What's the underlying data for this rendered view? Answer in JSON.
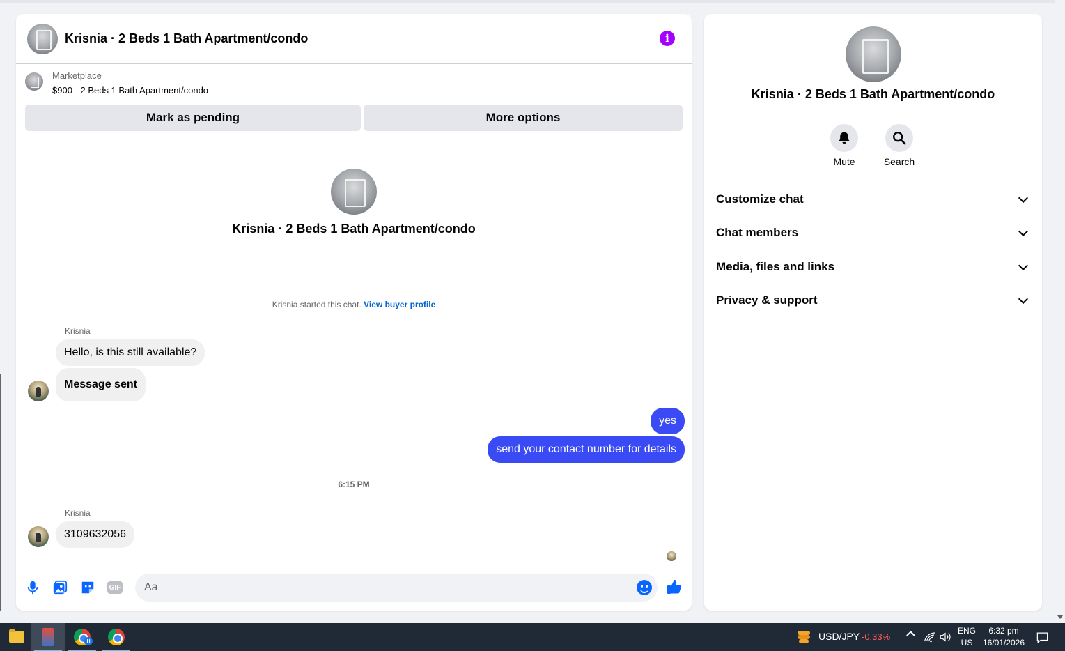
{
  "chat": {
    "header_title": "Krisnia · 2 Beds 1 Bath Apartment/condo",
    "info_icon_glyph": "i",
    "marketplace": {
      "label": "Marketplace",
      "listing": "$900 - 2 Beds 1 Bath Apartment/condo",
      "mark_pending_label": "Mark as pending",
      "more_options_label": "More options"
    },
    "intro_title": "Krisnia · 2 Beds 1 Bath Apartment/condo",
    "started_text": "Krisnia started this chat.",
    "view_buyer_profile": "View buyer profile",
    "messages": [
      {
        "sender": "Krisnia",
        "text": "Hello, is this still available?"
      },
      {
        "text": "Message sent"
      },
      {
        "text": "yes"
      },
      {
        "text": "send your contact number for details"
      },
      {
        "sender": "Krisnia",
        "text": "3109632056"
      }
    ],
    "timestamp": "6:15 PM",
    "composer": {
      "placeholder": "Aa",
      "gif_label": "GIF"
    }
  },
  "info_panel": {
    "title": "Krisnia · 2 Beds 1 Bath Apartment/condo",
    "actions": [
      {
        "label": "Mute",
        "icon": "bell-icon"
      },
      {
        "label": "Search",
        "icon": "search-icon"
      }
    ],
    "sections": [
      {
        "label": "Customize chat"
      },
      {
        "label": "Chat members"
      },
      {
        "label": "Media, files and links"
      },
      {
        "label": "Privacy & support"
      }
    ]
  },
  "taskbar": {
    "ticker_label": "USD/JPY",
    "ticker_change": "-0.33%",
    "chrome_badge": "H",
    "lang_top": "ENG",
    "lang_bottom": "US",
    "time": "6:32 pm",
    "date": "16/01/2026"
  },
  "colors": {
    "accent": "#0866ff",
    "outgoing_bubble": "#3a4bf5",
    "info_icon": "#a400ff",
    "ticker_negative": "#ff5b5b"
  }
}
